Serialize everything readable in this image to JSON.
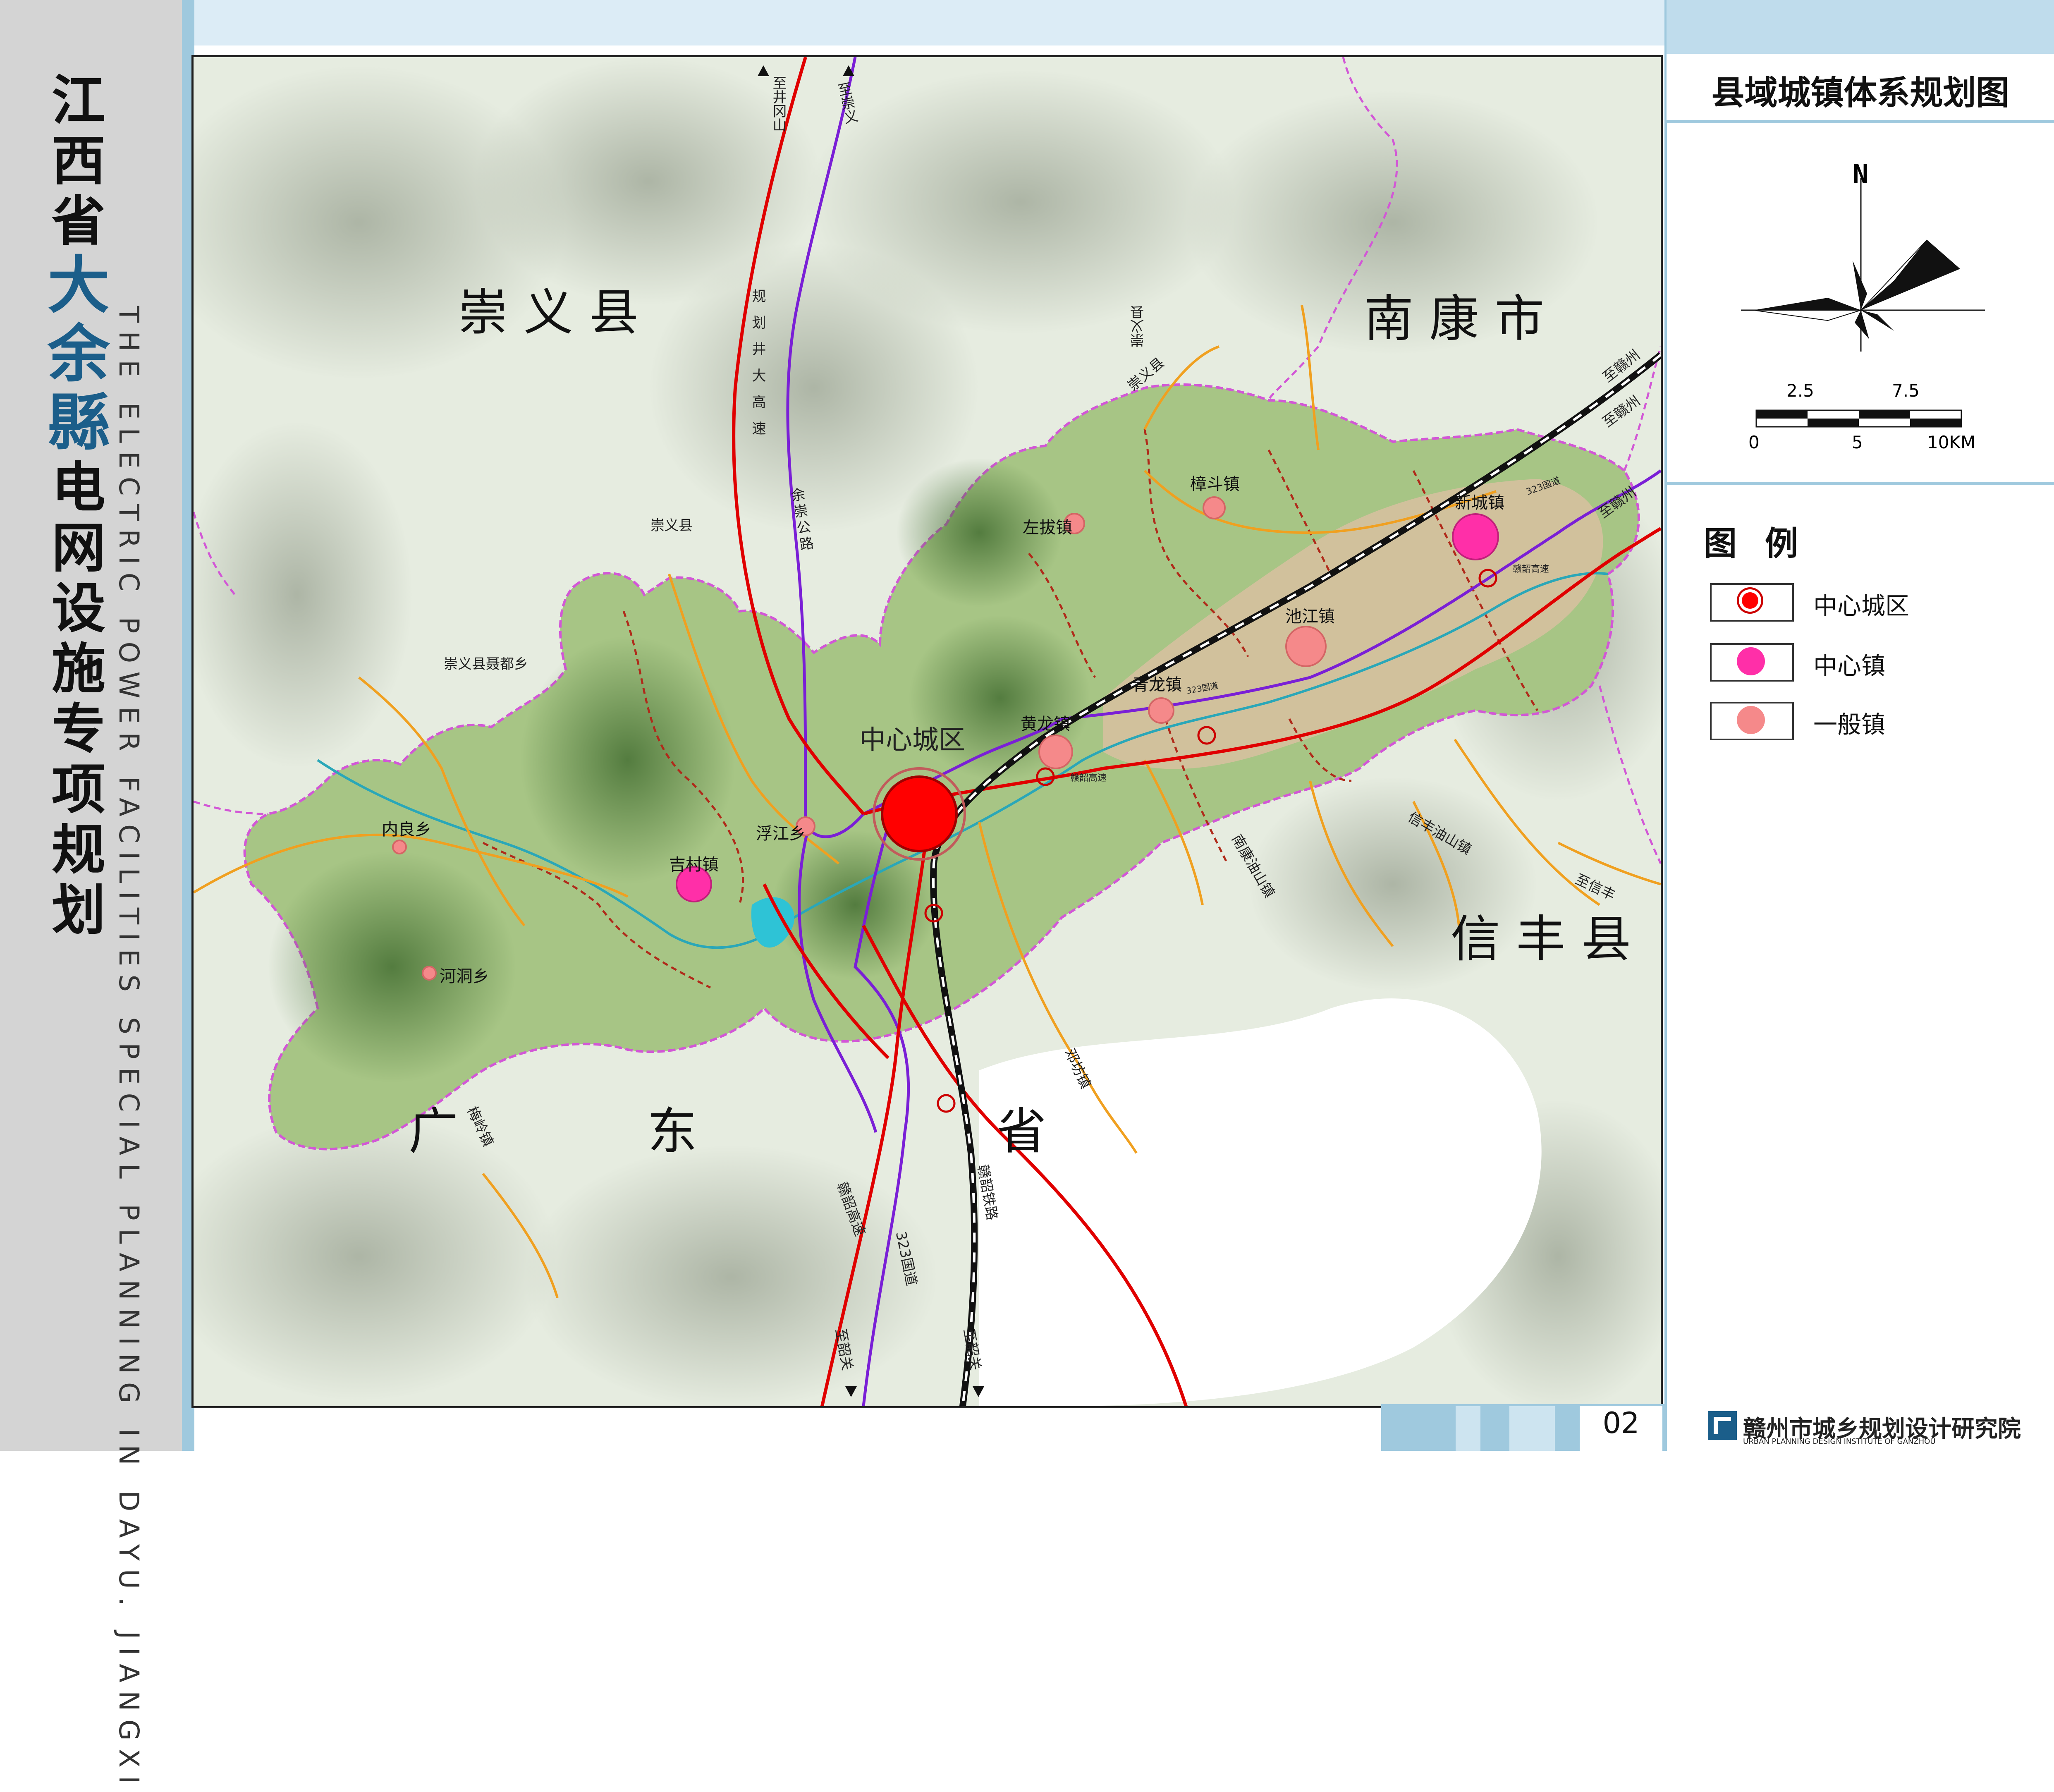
{
  "title": {
    "line1": [
      "江",
      "西",
      "省"
    ],
    "highlight": [
      "大",
      "余",
      "縣"
    ],
    "line2": [
      "电",
      "网",
      "设",
      "施",
      "专",
      "项",
      "规",
      "划"
    ],
    "english": "THE ELECTRIC POWER FACILITIES SPECIAL PLANNING IN DAYU. JIANGXI"
  },
  "map_title": "县域城镇体系规划图",
  "compass": {
    "north_label": "N"
  },
  "scale_bar": {
    "top_labels": [
      "2.5",
      "7.5"
    ],
    "bottom_labels": [
      "0",
      "5",
      "10KM"
    ]
  },
  "legend": {
    "title": "图 例",
    "items": [
      {
        "label": "中心城区",
        "color": "#ff0000"
      },
      {
        "label": "中心镇",
        "color": "#ff2fa8"
      },
      {
        "label": "一般镇",
        "color": "#f5898a"
      }
    ]
  },
  "regions": [
    {
      "name": "崇  义  县"
    },
    {
      "name": "南  康  市"
    },
    {
      "name": "信  丰  县"
    },
    {
      "name": "广            东                   省"
    }
  ],
  "towns": {
    "center_city": "中心城区",
    "central_towns": [
      "新城镇",
      "吉村镇"
    ],
    "general_towns": [
      "樟斗镇",
      "左拔镇",
      "池江镇",
      "青龙镇",
      "黄龙镇",
      "浮江乡",
      "内良乡",
      "河洞乡"
    ]
  },
  "road_labels": {
    "to_jinggangshan": "至井冈山",
    "to_chongyi": "至崇义",
    "planned_expressway": "规划井大高速",
    "yuchong_road": "余崇公路",
    "chongyi_county": "崇义县",
    "chongyi_nie": "崇义县聂都乡",
    "chongyi_top": "崇义县",
    "chongyi_top2": "崇义县",
    "to_ganzhou1": "至赣州",
    "to_ganzhou2": "至赣州",
    "to_ganzhou3": "至赣州",
    "nat323_ne": "323国道",
    "ganshao_exp_ne": "赣韶高速",
    "nat323_mid": "323国道",
    "ganshao_exp_mid": "赣韶高速",
    "xinfeng_youshan": "信丰油山镇",
    "nankang_youshan": "南康油山镇",
    "to_xinfeng": "至信丰",
    "dengfang": "邓坊镇",
    "meiling": "梅岭镇",
    "ganshao_exp_s": "赣韶高速",
    "ganshao_rail": "赣韶铁路",
    "nat323_s": "323国道",
    "to_shaoguan1": "至韶关",
    "to_shaoguan2": "至韶关"
  },
  "page_number": "02",
  "organization": {
    "name": "赣州市城乡规划设计研究院",
    "english": "URBAN PLANNING DESIGN INSTITUTE OF GANZHOU"
  },
  "colors": {
    "expressway": "#e00000",
    "national_road": "#7a1fd6",
    "county_road": "#f0a020",
    "railway": "#111111",
    "county_boundary": "#d257d6",
    "town_boundary": "#b02a1a",
    "river": "#2aa7b8",
    "dayu_land": "#a7c585",
    "urban_zone": "#d8bfa0"
  }
}
